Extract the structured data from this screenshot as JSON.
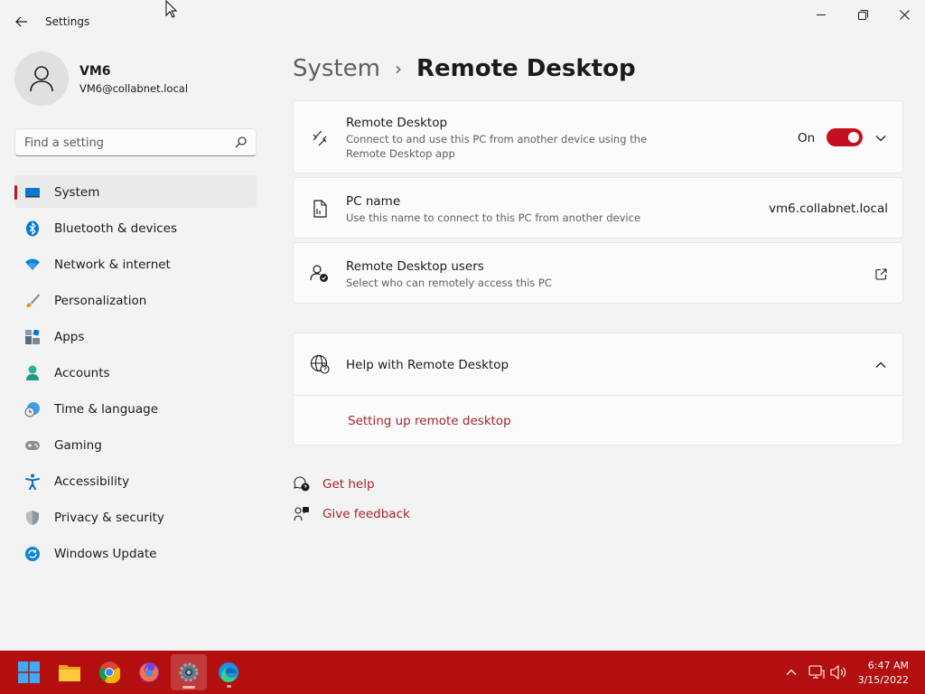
{
  "window": {
    "title": "Settings"
  },
  "profile": {
    "name": "VM6",
    "email": "VM6@collabnet.local"
  },
  "search": {
    "placeholder": "Find a setting"
  },
  "sidebar": {
    "items": [
      {
        "label": "System",
        "icon": "system-icon",
        "selected": true
      },
      {
        "label": "Bluetooth & devices",
        "icon": "bluetooth-icon"
      },
      {
        "label": "Network & internet",
        "icon": "wifi-icon"
      },
      {
        "label": "Personalization",
        "icon": "brush-icon"
      },
      {
        "label": "Apps",
        "icon": "apps-icon"
      },
      {
        "label": "Accounts",
        "icon": "person-icon"
      },
      {
        "label": "Time & language",
        "icon": "clock-globe-icon"
      },
      {
        "label": "Gaming",
        "icon": "gamepad-icon"
      },
      {
        "label": "Accessibility",
        "icon": "accessibility-icon"
      },
      {
        "label": "Privacy & security",
        "icon": "shield-icon"
      },
      {
        "label": "Windows Update",
        "icon": "update-icon"
      }
    ]
  },
  "breadcrumb": {
    "parent": "System",
    "separator": "›",
    "current": "Remote Desktop"
  },
  "remote_desktop": {
    "title": "Remote Desktop",
    "description": "Connect to and use this PC from another device using the Remote Desktop app",
    "state_label": "On",
    "enabled": true
  },
  "pc_name": {
    "title": "PC name",
    "description": "Use this name to connect to this PC from another device",
    "value": "vm6.collabnet.local"
  },
  "rd_users": {
    "title": "Remote Desktop users",
    "description": "Select who can remotely access this PC"
  },
  "help": {
    "title": "Help with Remote Desktop",
    "link": "Setting up remote desktop"
  },
  "footer": {
    "get_help": "Get help",
    "give_feedback": "Give feedback"
  },
  "taskbar": {
    "apps": [
      "start-icon",
      "file-explorer-icon",
      "chrome-icon",
      "firefox-icon",
      "settings-icon",
      "edge-icon"
    ],
    "time": "6:47 AM",
    "date": "3/15/2022"
  },
  "colors": {
    "accent": "#c50f1f",
    "link": "#a4262c",
    "taskbar": "#b30f0f"
  }
}
